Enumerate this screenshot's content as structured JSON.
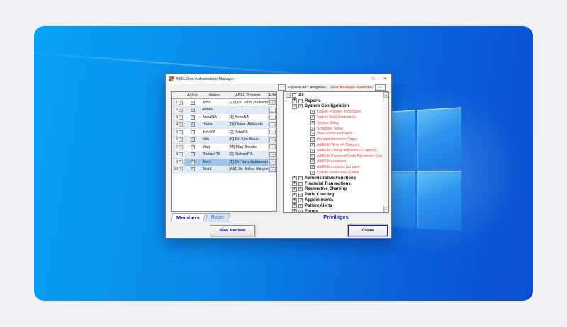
{
  "window": {
    "title": "ABELDent Authorization Manager",
    "minimize_glyph": "–",
    "maximize_glyph": "□",
    "close_glyph": "✕"
  },
  "toolbar": {
    "expand_toggle_label": ".",
    "expand_all_label": "Expand All Categories",
    "clear_overrides_label": "Clear Privilege Overrides",
    "overrides_more_label": "..."
  },
  "members_grid": {
    "columns": [
      "",
      "Active",
      "Name",
      "ABEL Provider",
      "Edit"
    ],
    "row_expander_glyph": "+",
    "edit_button_label": "...",
    "check_glyph": "✓",
    "rows": [
      {
        "num": "1",
        "active": true,
        "name": "John",
        "provider": "[ZZ] Dr. John Zuckerman",
        "selected": false
      },
      {
        "num": "2",
        "active": true,
        "name": "admin",
        "provider": "",
        "selected": false
      },
      {
        "num": "3",
        "active": true,
        "name": "AnnaNA",
        "provider": "[1] AnnaNA",
        "selected": false
      },
      {
        "num": "4",
        "active": true,
        "name": "Diane",
        "provider": "[D] Diane Wekarski",
        "selected": false
      },
      {
        "num": "5",
        "active": true,
        "name": "JohnFA",
        "provider": "[2] JohnFA",
        "selected": false
      },
      {
        "num": "6",
        "active": true,
        "name": "Kim",
        "provider": "[K] Dr. Kim Black",
        "selected": false
      },
      {
        "num": "7",
        "active": true,
        "name": "Marj",
        "provider": "[M] Marj Brooks",
        "selected": false
      },
      {
        "num": "8",
        "active": true,
        "name": "RichardTA",
        "provider": "[3] RichardTA",
        "selected": false
      },
      {
        "num": "9",
        "active": true,
        "name": "Terry",
        "provider": "[T] Dr. Terry Ackerman",
        "selected": true
      },
      {
        "num": "10",
        "active": true,
        "name": "Test1",
        "provider": "[AM] Dr. Arthur Meighen",
        "selected": false
      }
    ]
  },
  "tabs": {
    "members_label": "Members",
    "roles_label": "Roles"
  },
  "privileges": {
    "label": "Privileges",
    "scroll_up_glyph": "▲",
    "scroll_down_glyph": "▼",
    "tree": [
      {
        "label": "All",
        "level": 0,
        "expander": "-",
        "checked": false
      },
      {
        "label": "Reports",
        "level": 1,
        "expander": "+",
        "checked": false
      },
      {
        "label": "System Configuration",
        "level": 1,
        "expander": "-",
        "checked": true
      },
      {
        "label": "Update Provider Information",
        "level": 2,
        "checked": true
      },
      {
        "label": "Update Bank Information",
        "level": 2,
        "checked": true
      },
      {
        "label": "System Setup",
        "level": 2,
        "checked": true
      },
      {
        "label": "Scheduler Setup",
        "level": 2,
        "checked": true
      },
      {
        "label": "View Scheduler Pages",
        "level": 2,
        "checked": true
      },
      {
        "label": "Manage Scheduler Pages",
        "level": 2,
        "checked": true
      },
      {
        "label": "Add/Edit Write off Category",
        "level": 2,
        "checked": true
      },
      {
        "label": "Add/Edit Charge Adjustment Category",
        "level": 2,
        "checked": true
      },
      {
        "label": "Add/Edit Payment/Credit Adjustment Category",
        "level": 2,
        "checked": true
      },
      {
        "label": "Add/Edit Locations",
        "level": 2,
        "checked": true
      },
      {
        "label": "Add/Edit Location Contacts",
        "level": 2,
        "checked": true
      },
      {
        "label": "Update Dental Fee Guides",
        "level": 2,
        "checked": true
      },
      {
        "label": "Administrative Functions",
        "level": 1,
        "expander": "+",
        "checked": true
      },
      {
        "label": "Financial Transactions",
        "level": 1,
        "expander": "+",
        "checked": false
      },
      {
        "label": "Restorative Charting",
        "level": 1,
        "expander": "+",
        "checked": true
      },
      {
        "label": "Perio Charting",
        "level": 1,
        "expander": "+",
        "checked": true
      },
      {
        "label": "Appointments",
        "level": 1,
        "expander": "+",
        "checked": true
      },
      {
        "label": "Patient Alerts",
        "level": 1,
        "expander": "+",
        "checked": true
      },
      {
        "label": "Forms",
        "level": 1,
        "expander": "+",
        "checked": true
      }
    ]
  },
  "footer_buttons": {
    "new_member_label": "New Member",
    "close_label": "Close"
  },
  "colors": {
    "desktop_blue_light": "#07a1f4",
    "desktop_blue_dark": "#0b4ed0",
    "privilege_item_red": "#e04444",
    "accent_navy": "#14148c",
    "selection_blue": "#9cc5ec",
    "clear_overrides_red": "#c32222"
  }
}
